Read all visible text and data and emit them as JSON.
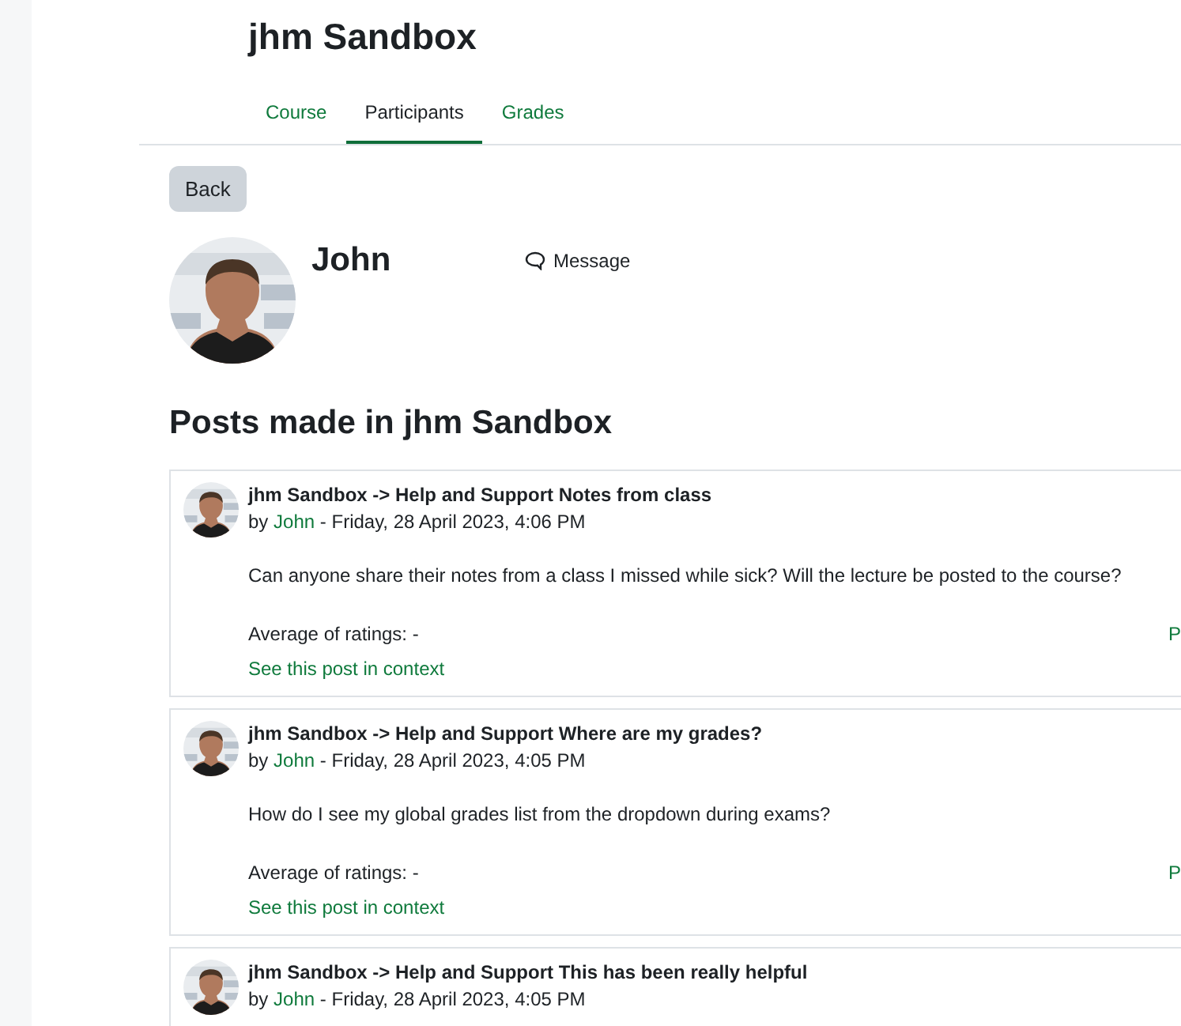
{
  "course": {
    "title": "jhm Sandbox"
  },
  "tabs": [
    {
      "label": "Course",
      "selected": false
    },
    {
      "label": "Participants",
      "selected": true
    },
    {
      "label": "Grades",
      "selected": false
    }
  ],
  "back_button": "Back",
  "profile": {
    "name": "John",
    "message_link": "Message"
  },
  "posts_heading": "Posts made in jhm Sandbox",
  "posts": [
    {
      "subject": "jhm Sandbox -> Help and Support Notes from class",
      "by": "by",
      "author": "John",
      "date": "- Friday, 28 April 2023, 4:06 PM",
      "message": "Can anyone share their notes from a class I missed while sick? Will the lecture be posted to the course?",
      "ratings": "Average of ratings: -",
      "right_link": "P",
      "context_link": "See this post in context"
    },
    {
      "subject": "jhm Sandbox -> Help and Support Where are my grades?",
      "by": "by",
      "author": "John",
      "date": "- Friday, 28 April 2023, 4:05 PM",
      "message": "How do I see my global grades list from the dropdown during exams?",
      "ratings": "Average of ratings: -",
      "right_link": "P",
      "context_link": "See this post in context"
    },
    {
      "subject": "jhm Sandbox -> Help and Support This has been really helpful",
      "by": "by",
      "author": "John",
      "date": "- Friday, 28 April 2023, 4:05 PM"
    }
  ]
}
